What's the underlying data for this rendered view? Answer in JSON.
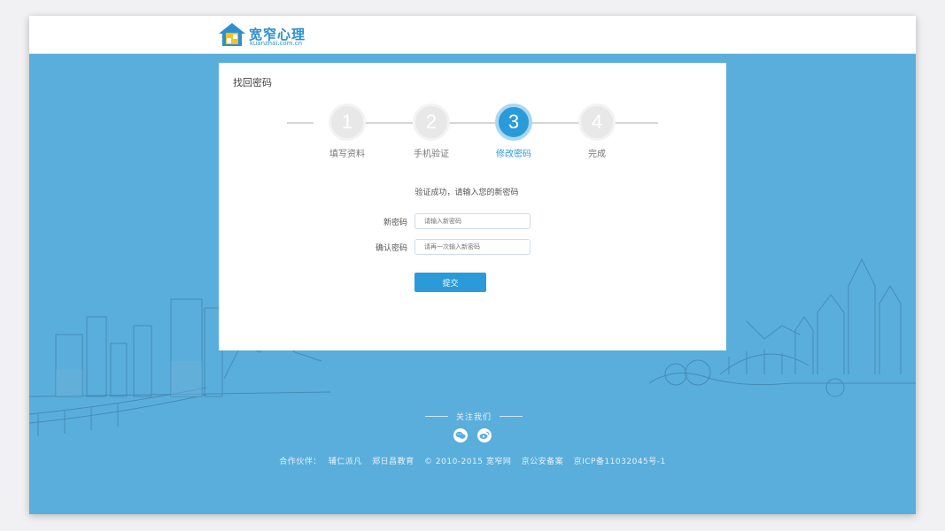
{
  "header": {
    "logo_title": "宽窄心理",
    "logo_domain": "kuanzhai.com.cn"
  },
  "card": {
    "title": "找回密码",
    "steps": [
      {
        "number": "1",
        "label": "填写资料",
        "active": false
      },
      {
        "number": "2",
        "label": "手机验证",
        "active": false
      },
      {
        "number": "3",
        "label": "修改密码",
        "active": true
      },
      {
        "number": "4",
        "label": "完成",
        "active": false
      }
    ],
    "hint": "验证成功，请输入您的新密码",
    "new_password": {
      "label": "新密码",
      "placeholder": "请输入新密码",
      "value": ""
    },
    "confirm_password": {
      "label": "确认密码",
      "placeholder": "请再一次输入新密码",
      "value": ""
    },
    "submit_label": "提交"
  },
  "footer": {
    "follow_label": "关注我们",
    "social_icons": [
      "wechat-icon",
      "weibo-icon"
    ],
    "partners_label": "合作伙伴：",
    "partner_1": "辅仁派凡",
    "partner_2": "郑日昌教育",
    "copyright": "© 2010-2015 宽窄网",
    "police_record": "京公安备案",
    "icp": "京ICP备11032045号-1"
  },
  "colors": {
    "accent": "#2a9bd8",
    "background": "#5aaedb",
    "brand": "#2d8fd0"
  }
}
